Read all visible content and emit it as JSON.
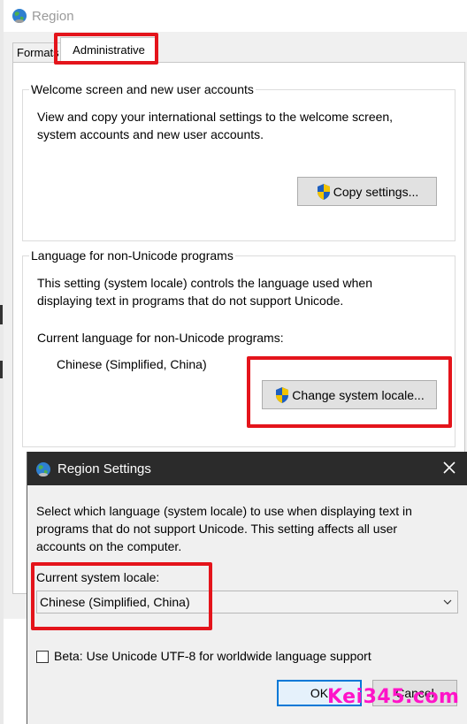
{
  "region_window": {
    "title": "Region",
    "tabs": [
      "Formats",
      "Administrative"
    ],
    "welcome_group": {
      "legend": "Welcome screen and new user accounts",
      "description_line1": "View and copy your international settings to the welcome screen,",
      "description_line2": "system accounts and new user accounts.",
      "copy_button": "Copy settings..."
    },
    "unicode_group": {
      "legend": "Language for non-Unicode programs",
      "description_line1": "This setting (system locale) controls the language used when",
      "description_line2": "displaying text in programs that do not support Unicode.",
      "current_label": "Current language for non-Unicode programs:",
      "current_value": "Chinese (Simplified, China)",
      "change_button": "Change system locale..."
    }
  },
  "region_settings_dialog": {
    "title": "Region Settings",
    "description_line1": "Select which language (system locale) to use when displaying text in",
    "description_line2": "programs that do not support Unicode. This setting affects all user",
    "description_line3": "accounts on the computer.",
    "locale_label": "Current system locale:",
    "locale_value": "Chinese (Simplified, China)",
    "beta_checkbox_label": "Beta: Use Unicode UTF-8 for worldwide language support",
    "beta_checked": false,
    "ok_button": "OK",
    "cancel_button": "Cancel"
  },
  "watermark": "Kei345.com",
  "colors": {
    "highlight": "#e4141b",
    "watermark": "#ff14c8",
    "dialog_titlebar": "#2b2b2b",
    "ok_border": "#0078d7"
  },
  "icons": [
    "globe-icon",
    "shield-icon",
    "close-icon",
    "chevron-down-icon"
  ]
}
